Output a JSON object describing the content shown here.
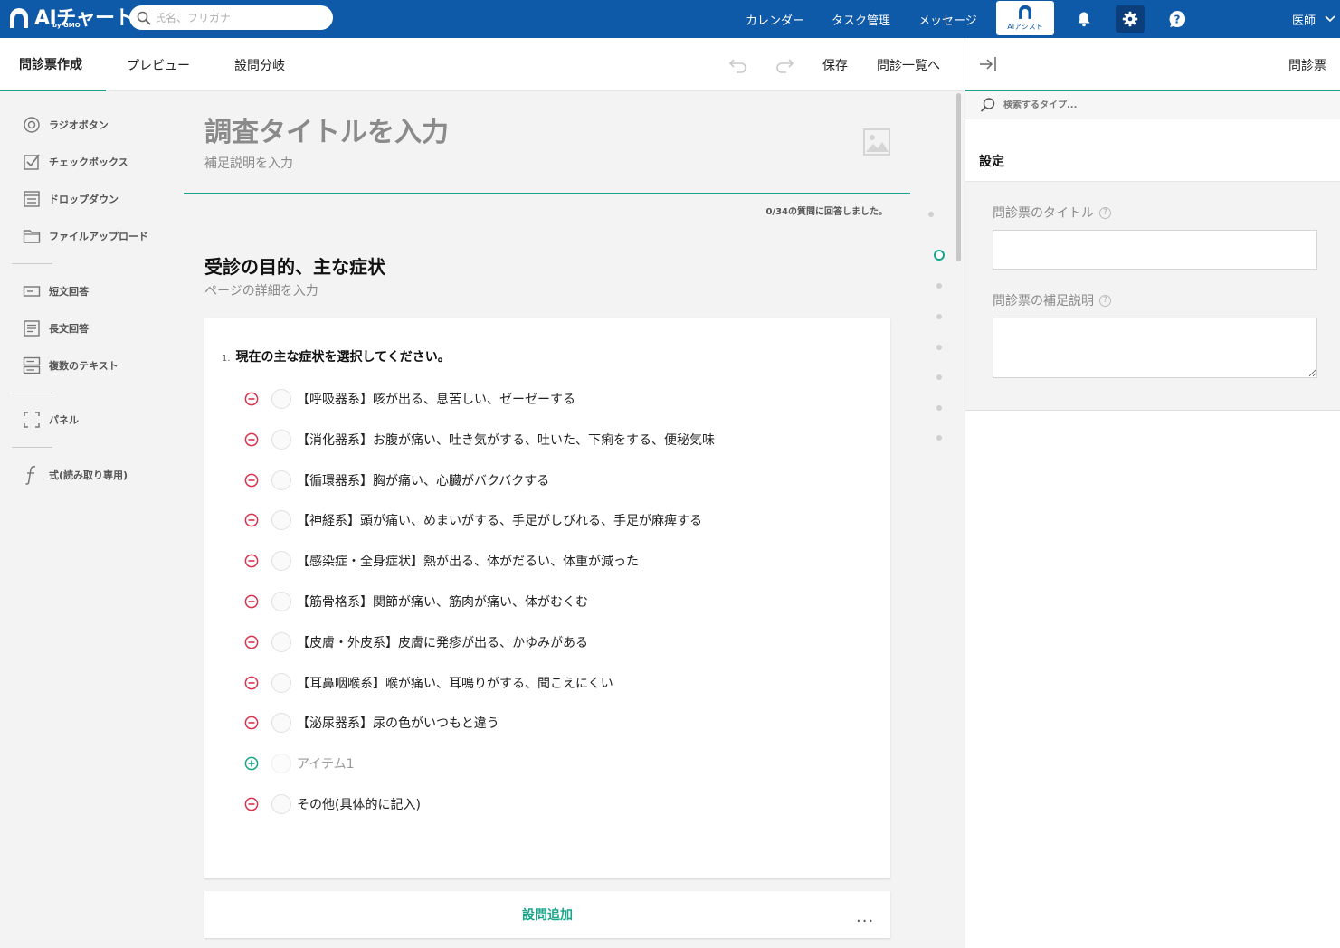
{
  "app": {
    "brand": "AIチャート",
    "brand_sub": "by GMO",
    "search_placeholder": "氏名、フリガナ",
    "nav": [
      "カレンダー",
      "タスク管理",
      "メッセージ"
    ],
    "ai_assist_label": "AIアシスト",
    "user_label": "医師",
    "accent_color": "#0f5aa8",
    "brand_green": "#1aa58a"
  },
  "toolbar": {
    "tabs": [
      "問診票作成",
      "プレビュー",
      "設問分岐"
    ],
    "active_tab": "問診票作成",
    "save_label": "保存",
    "back_label": "問診一覧へ"
  },
  "palette": {
    "items": [
      {
        "label": "ラジオボタン",
        "icon": "radio-icon"
      },
      {
        "label": "チェックボックス",
        "icon": "checkbox-icon"
      },
      {
        "label": "ドロップダウン",
        "icon": "dropdown-icon"
      },
      {
        "label": "ファイルアップロード",
        "icon": "folder-icon"
      },
      {
        "label": "短文回答",
        "icon": "short-text-icon"
      },
      {
        "label": "長文回答",
        "icon": "long-text-icon"
      },
      {
        "label": "複数のテキスト",
        "icon": "multiple-text-icon"
      },
      {
        "label": "パネル",
        "icon": "panel-icon"
      },
      {
        "label": "式(読み取り専用)",
        "icon": "formula-icon"
      }
    ]
  },
  "survey": {
    "title_placeholder": "調査タイトルを入力",
    "desc_placeholder": "補足説明を入力",
    "progress": "0/34の質問に回答しました。",
    "page_title": "受診の目的、主な症状",
    "page_desc": "ページの詳細を入力",
    "question": {
      "number": "1.",
      "title": "現在の主な症状を選択してください。",
      "choices": [
        "【呼吸器系】咳が出る、息苦しい、ゼーゼーする",
        "【消化器系】お腹が痛い、吐き気がする、吐いた、下痢をする、便秘気味",
        "【循環器系】胸が痛い、心臓がバクバクする",
        "【神経系】頭が痛い、めまいがする、手足がしびれる、手足が麻痺する",
        "【感染症・全身症状】熱が出る、体がだるい、体重が減った",
        "【筋骨格系】関節が痛い、筋肉が痛い、体がむくむ",
        "【皮膚・外皮系】皮膚に発疹が出る、かゆみがある",
        "【耳鼻咽喉系】喉が痛い、耳鳴りがする、聞こえにくい",
        "【泌尿器系】尿の色がいつもと違う"
      ],
      "new_item": "アイテム1",
      "other": "その他(具体的に記入)"
    },
    "add_question": "設問追加",
    "more": "..."
  },
  "right_panel": {
    "title": "問診票",
    "search_placeholder": "検索するタイプ...",
    "section": "設定",
    "field_title_label": "問診票のタイトル",
    "field_desc_label": "問診票の補足説明",
    "help": "?"
  }
}
